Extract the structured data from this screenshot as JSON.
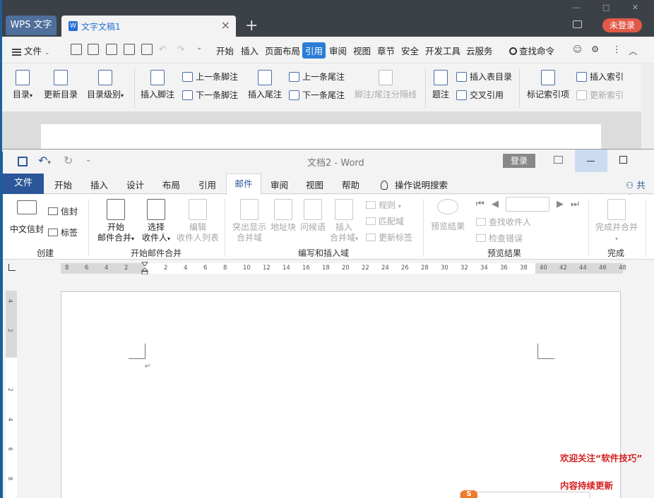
{
  "wps": {
    "app_tab": "WPS 文字",
    "doc_tab": "文字文稿1",
    "new_tab": "+",
    "login": "未登录",
    "menu": {
      "file": "文件",
      "tabs": [
        "开始",
        "插入",
        "页面布局",
        "引用",
        "审阅",
        "视图",
        "章节",
        "安全",
        "开发工具",
        "云服务"
      ],
      "active_tab": "引用",
      "search": "查找命令"
    },
    "ribbon": {
      "toc": "目录",
      "update_toc": "更新目录",
      "toc_level": "目录级别",
      "insert_footnote": "插入脚注",
      "prev_footnote": "上一条脚注",
      "next_footnote": "下一条脚注",
      "insert_endnote": "插入尾注",
      "prev_endnote": "上一条尾注",
      "next_endnote": "下一条尾注",
      "separator": "脚注/尾注分隔线",
      "caption": "题注",
      "insert_table_of_figures": "插入表目录",
      "cross_reference": "交叉引用",
      "mark_entry": "标记索引项",
      "insert_index": "插入索引",
      "update_index": "更新索引"
    }
  },
  "word": {
    "doc_title": "文档2  -  Word",
    "login": "登录",
    "tabs": {
      "file": "文件",
      "home": "开始",
      "insert": "插入",
      "design": "设计",
      "layout": "布局",
      "references": "引用",
      "mailings": "邮件",
      "review": "审阅",
      "view": "视图",
      "help": "帮助",
      "tell_me": "操作说明搜索",
      "share": "共享"
    },
    "ribbon": {
      "chinese_envelope": "中文信封",
      "envelopes": "信封",
      "labels": "标签",
      "group_create": "创建",
      "start_merge_1": "开始",
      "start_merge_2": "邮件合并",
      "select_recipients_1": "选择",
      "select_recipients_2": "收件人",
      "edit_list_1": "编辑",
      "edit_list_2": "收件人列表",
      "group_start_merge": "开始邮件合并",
      "highlight_fields_1": "突出显示",
      "highlight_fields_2": "合并域",
      "address_block": "地址块",
      "greeting_line": "问候语",
      "insert_field_1": "插入",
      "insert_field_2": "合并域",
      "rules": "规则",
      "match_fields": "匹配域",
      "update_labels": "更新标签",
      "group_write_insert": "编写和插入域",
      "preview_results": "预览结果",
      "find_recipient": "查找收件人",
      "check_errors": "检查错误",
      "group_preview": "预览结果",
      "finish_merge": "完成并合并",
      "group_finish": "完成"
    },
    "ruler_ticks": [
      "8",
      "6",
      "4",
      "2",
      "",
      "2",
      "4",
      "6",
      "8",
      "10",
      "12",
      "14",
      "16",
      "18",
      "20",
      "22",
      "24",
      "26",
      "28",
      "30",
      "32",
      "34",
      "36",
      "38",
      "40",
      "42",
      "44",
      "46",
      "48"
    ],
    "vruler_ticks": [
      "4",
      "2",
      "",
      "2",
      "4",
      "6",
      "8"
    ]
  },
  "watermark": {
    "line1": "欢迎关注“软件技巧”",
    "line2": "内容持续更新"
  },
  "colors": {
    "wps_accent": "#2b7cd8",
    "word_blue": "#2b579a",
    "login_red": "#e15a48",
    "watermark_red": "#d62020"
  }
}
